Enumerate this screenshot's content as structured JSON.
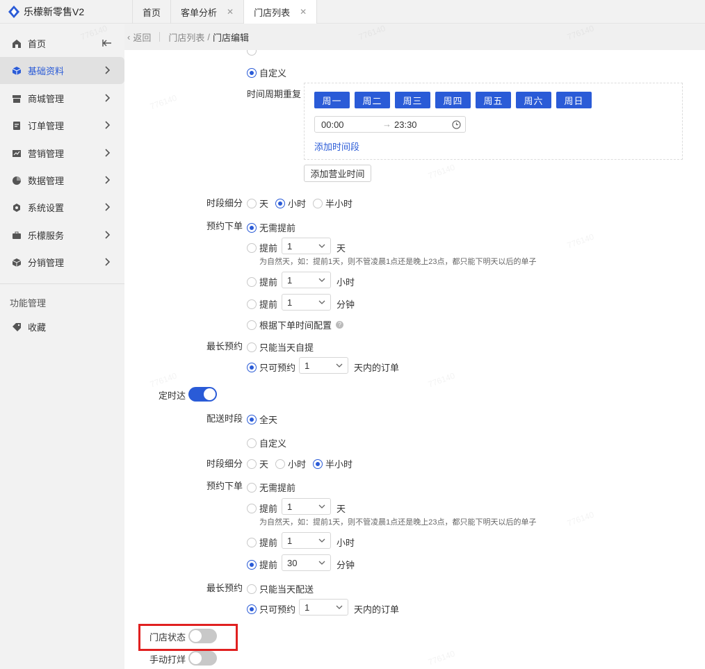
{
  "app": {
    "title": "乐檬新零售V2"
  },
  "tabs": [
    {
      "label": "首页",
      "closable": false
    },
    {
      "label": "客单分析",
      "closable": true
    },
    {
      "label": "门店列表",
      "closable": true,
      "active": true
    }
  ],
  "sidebar": {
    "items": [
      {
        "label": "首页",
        "icon": "home-icon"
      },
      {
        "label": "基础资料",
        "icon": "cube-icon",
        "active": true
      },
      {
        "label": "商城管理",
        "icon": "store-icon"
      },
      {
        "label": "订单管理",
        "icon": "order-icon"
      },
      {
        "label": "营销管理",
        "icon": "marketing-icon"
      },
      {
        "label": "数据管理",
        "icon": "pie-chart-icon"
      },
      {
        "label": "系统设置",
        "icon": "settings-icon"
      },
      {
        "label": "乐檬服务",
        "icon": "briefcase-icon"
      },
      {
        "label": "分销管理",
        "icon": "box-icon"
      }
    ],
    "section_title": "功能管理",
    "favorites_label": "收藏"
  },
  "breadcrumb": {
    "back": "返回",
    "parent": "门店列表",
    "sep": "/",
    "current": "门店编辑"
  },
  "pickup": {
    "custom_label": "自定义",
    "repeat_label": "时间周期重复",
    "days": [
      "周一",
      "周二",
      "周三",
      "周四",
      "周五",
      "周六",
      "周日"
    ],
    "time_start": "00:00",
    "time_end": "23:30",
    "add_time_slot": "添加时间段",
    "add_business_hours": "添加营业时间",
    "granularity_label": "时段细分",
    "granularity_options": [
      "天",
      "小时",
      "半小时"
    ],
    "preorder_label": "预约下单",
    "no_advance": "无需提前",
    "advance": "提前",
    "adv_day_value": "1",
    "unit_day": "天",
    "hint": "为自然天，如：提前1天，则不管凌晨1点还是晚上23点，都只能下明天以后的单子",
    "adv_hour_value": "1",
    "unit_hour": "小时",
    "adv_min_value": "1",
    "unit_min": "分钟",
    "by_order_time": "根据下单时间配置",
    "max_label": "最长预约",
    "max_today": "只能当天自提",
    "max_only": "只可预约",
    "max_value": "1",
    "max_suffix": "天内的订单"
  },
  "scheduled": {
    "label": "定时达",
    "delivery_period_label": "配送时段",
    "all_day": "全天",
    "custom_label": "自定义",
    "granularity_label": "时段细分",
    "granularity_options": [
      "天",
      "小时",
      "半小时"
    ],
    "preorder_label": "预约下单",
    "no_advance": "无需提前",
    "advance": "提前",
    "adv_day_value": "1",
    "unit_day": "天",
    "hint": "为自然天，如：提前1天，则不管凌晨1点还是晚上23点，都只能下明天以后的单子",
    "adv_hour_value": "1",
    "unit_hour": "小时",
    "adv_min_value": "30",
    "unit_min": "分钟",
    "max_label": "最长预约",
    "max_today": "只能当天配送",
    "max_only": "只可预约",
    "max_value": "1",
    "max_suffix": "天内的订单"
  },
  "store_status_label": "门店状态",
  "manual_pack_label": "手动打烊",
  "watermark": "776140",
  "colors": {
    "primary": "#2a5bd7",
    "highlight": "#e02020"
  }
}
